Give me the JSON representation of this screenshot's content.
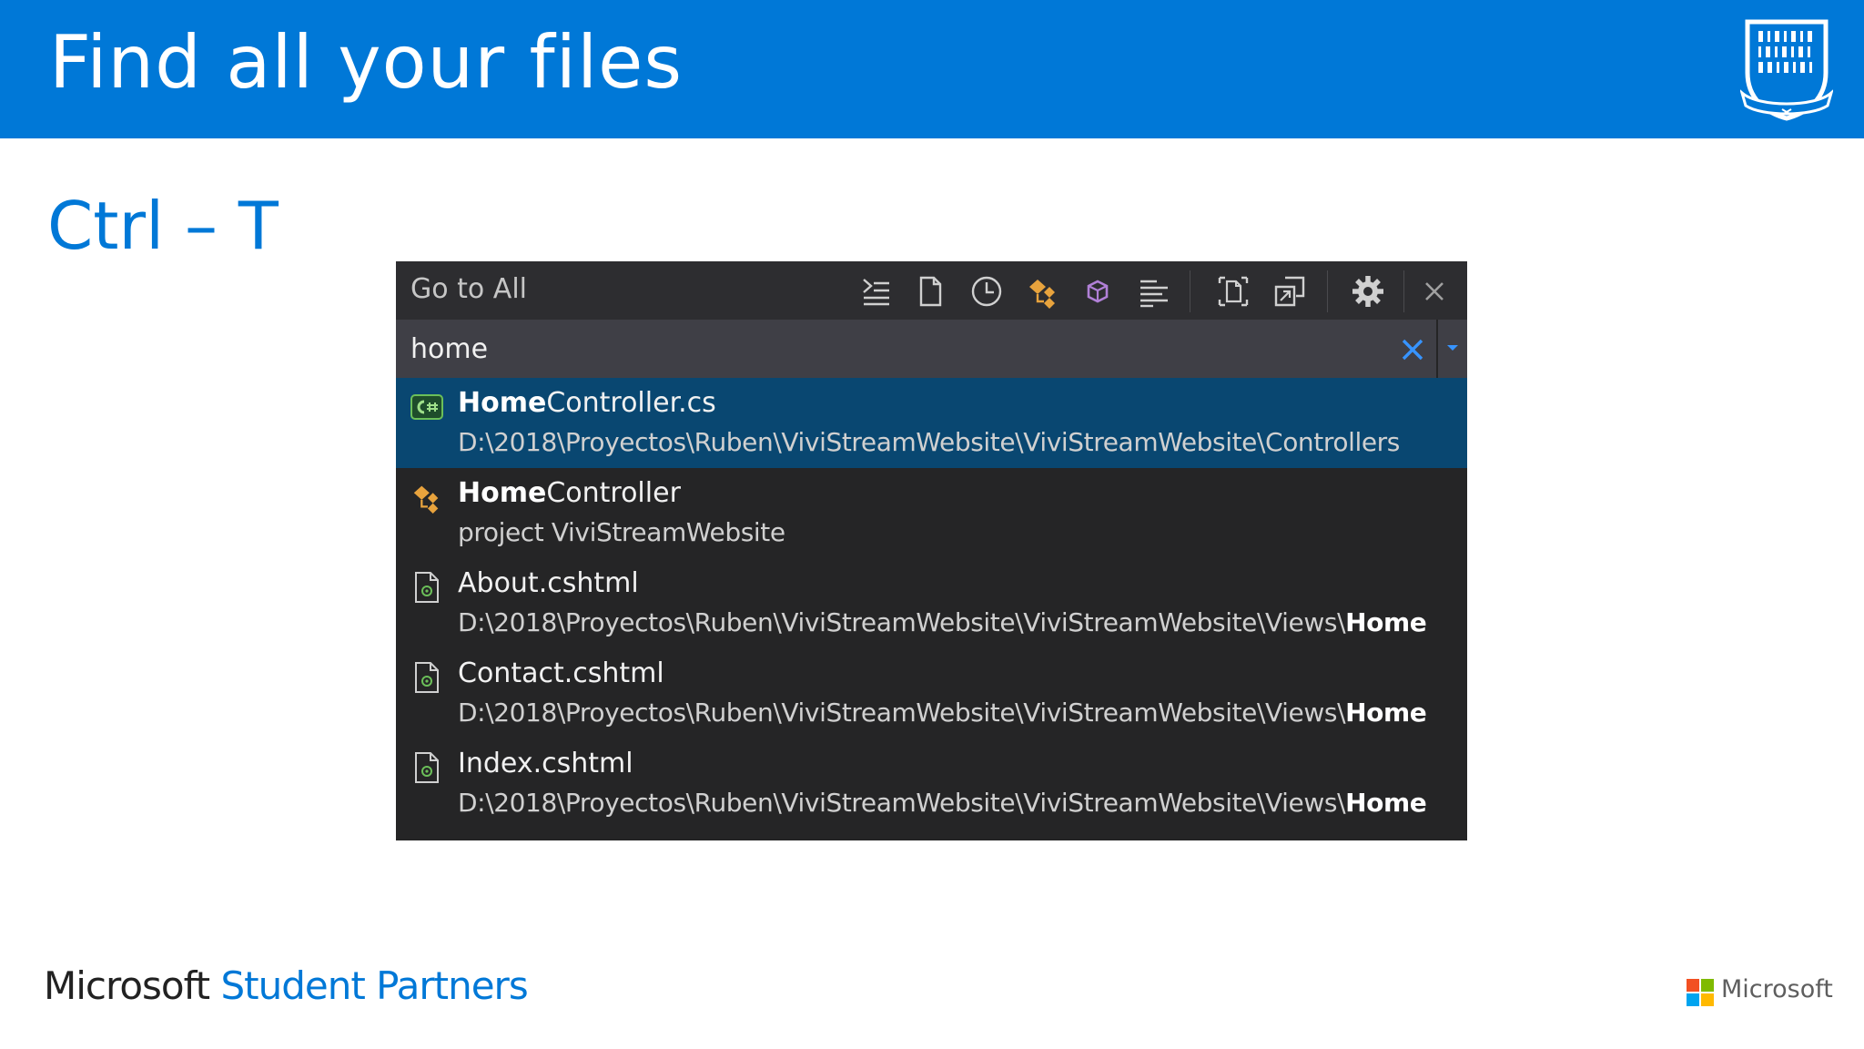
{
  "slide": {
    "title": "Find all your files",
    "subtitle": "Ctrl – T",
    "colors": {
      "accent": "#0078d7",
      "panel_bg": "#252526",
      "selection": "#094771"
    }
  },
  "goto_panel": {
    "title": "Go to All",
    "toolbar_icons": [
      "line-icon",
      "file-icon",
      "recent-icon",
      "type-icon",
      "member-icon",
      "symbol-icon",
      "current-document-icon",
      "separate-window-icon",
      "settings-gear-icon",
      "close-icon"
    ],
    "search": {
      "value": "home",
      "placeholder": ""
    },
    "results": [
      {
        "name_bold": "Home",
        "name_rest": "Controller.cs",
        "path_start": "D:\\2018\\Proyectos\\Ruben\\ViviStreamWebsite\\ViviStreamWebsite\\Controllers",
        "path_bold": "",
        "icon": "csharp-file-icon",
        "selected": true
      },
      {
        "name_bold": "Home",
        "name_rest": "Controller",
        "path_start": "project ViviStreamWebsite",
        "path_bold": "",
        "icon": "class-icon",
        "selected": false
      },
      {
        "name_bold": "",
        "name_rest": "About.cshtml",
        "path_start": "D:\\2018\\Proyectos\\Ruben\\ViviStreamWebsite\\ViviStreamWebsite\\Views\\",
        "path_bold": "Home",
        "icon": "razor-file-icon",
        "selected": false
      },
      {
        "name_bold": "",
        "name_rest": "Contact.cshtml",
        "path_start": "D:\\2018\\Proyectos\\Ruben\\ViviStreamWebsite\\ViviStreamWebsite\\Views\\",
        "path_bold": "Home",
        "icon": "razor-file-icon",
        "selected": false
      },
      {
        "name_bold": "",
        "name_rest": "Index.cshtml",
        "path_start": "D:\\2018\\Proyectos\\Ruben\\ViviStreamWebsite\\ViviStreamWebsite\\Views\\",
        "path_bold": "Home",
        "icon": "razor-file-icon",
        "selected": false
      }
    ]
  },
  "footer": {
    "brand_part1": "Microsoft",
    "brand_part2": "Student Partners",
    "ms_logo_text": "Microsoft"
  }
}
